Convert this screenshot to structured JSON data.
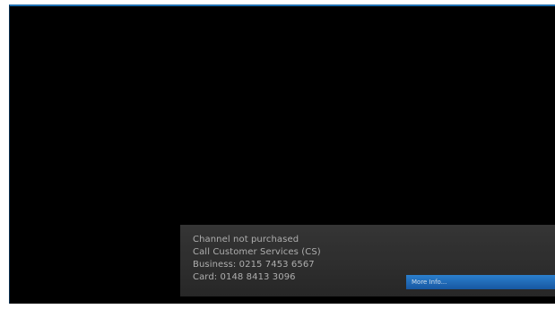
{
  "osd_message": {
    "lines": [
      "Channel not purchased",
      "Call Customer Services (CS)",
      "Business: 0215 7453 6567",
      "Card: 0148 8413 3096"
    ],
    "more_button_label": "More Info..."
  },
  "colors": {
    "screen_background": "#000000",
    "panel_background": "#333333",
    "button_accent": "#1f72c8",
    "screen_border_accent": "#1e6fb0"
  }
}
